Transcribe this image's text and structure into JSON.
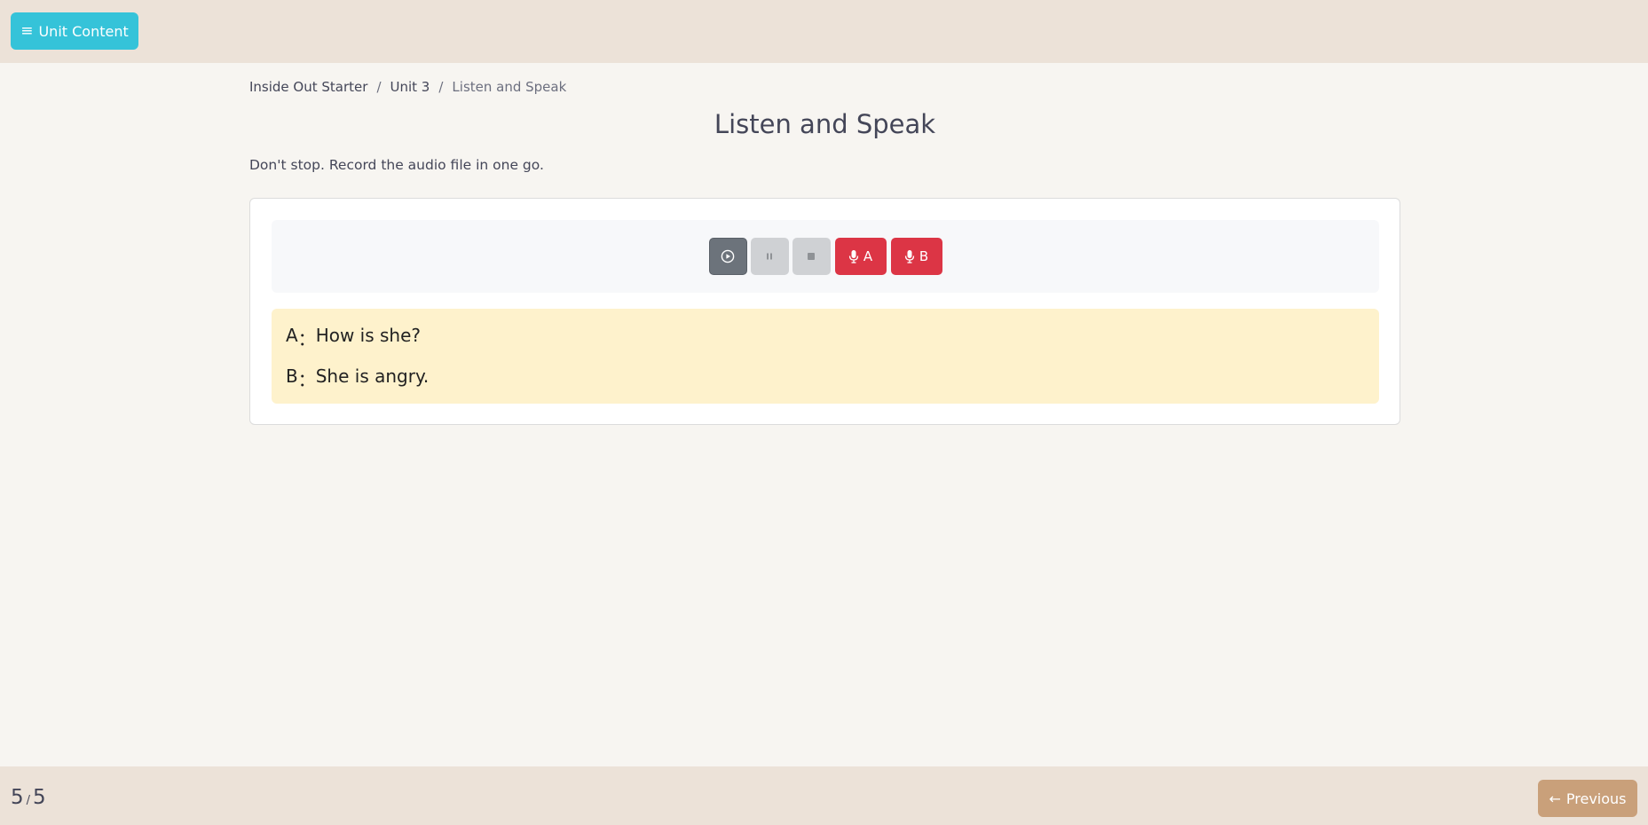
{
  "header": {
    "menu_button_label": "Unit Content",
    "menu_icon_glyph": "≡",
    "accent_color": "#35c3d9"
  },
  "breadcrumb": {
    "items": [
      "Inside Out Starter",
      "Unit 3",
      "Listen and Speak"
    ],
    "separator": "/"
  },
  "page": {
    "title": "Listen and Speak",
    "instruction": "Don't stop. Record the audio file in one go."
  },
  "player": {
    "play_icon": "play-circle-icon",
    "pause_icon": "pause-icon",
    "stop_icon": "stop-icon",
    "record_a_label": "A",
    "record_b_label": "B",
    "record_color": "#dc3545"
  },
  "dialog": {
    "lines": [
      {
        "speaker": "A",
        "separator": "：",
        "text": "How is she?"
      },
      {
        "speaker": "B",
        "separator": "：",
        "text": "She is angry."
      }
    ]
  },
  "footer": {
    "current_page": "5",
    "page_separator": "/",
    "total_pages": "5",
    "previous_label": "Previous",
    "previous_arrow": "←"
  }
}
